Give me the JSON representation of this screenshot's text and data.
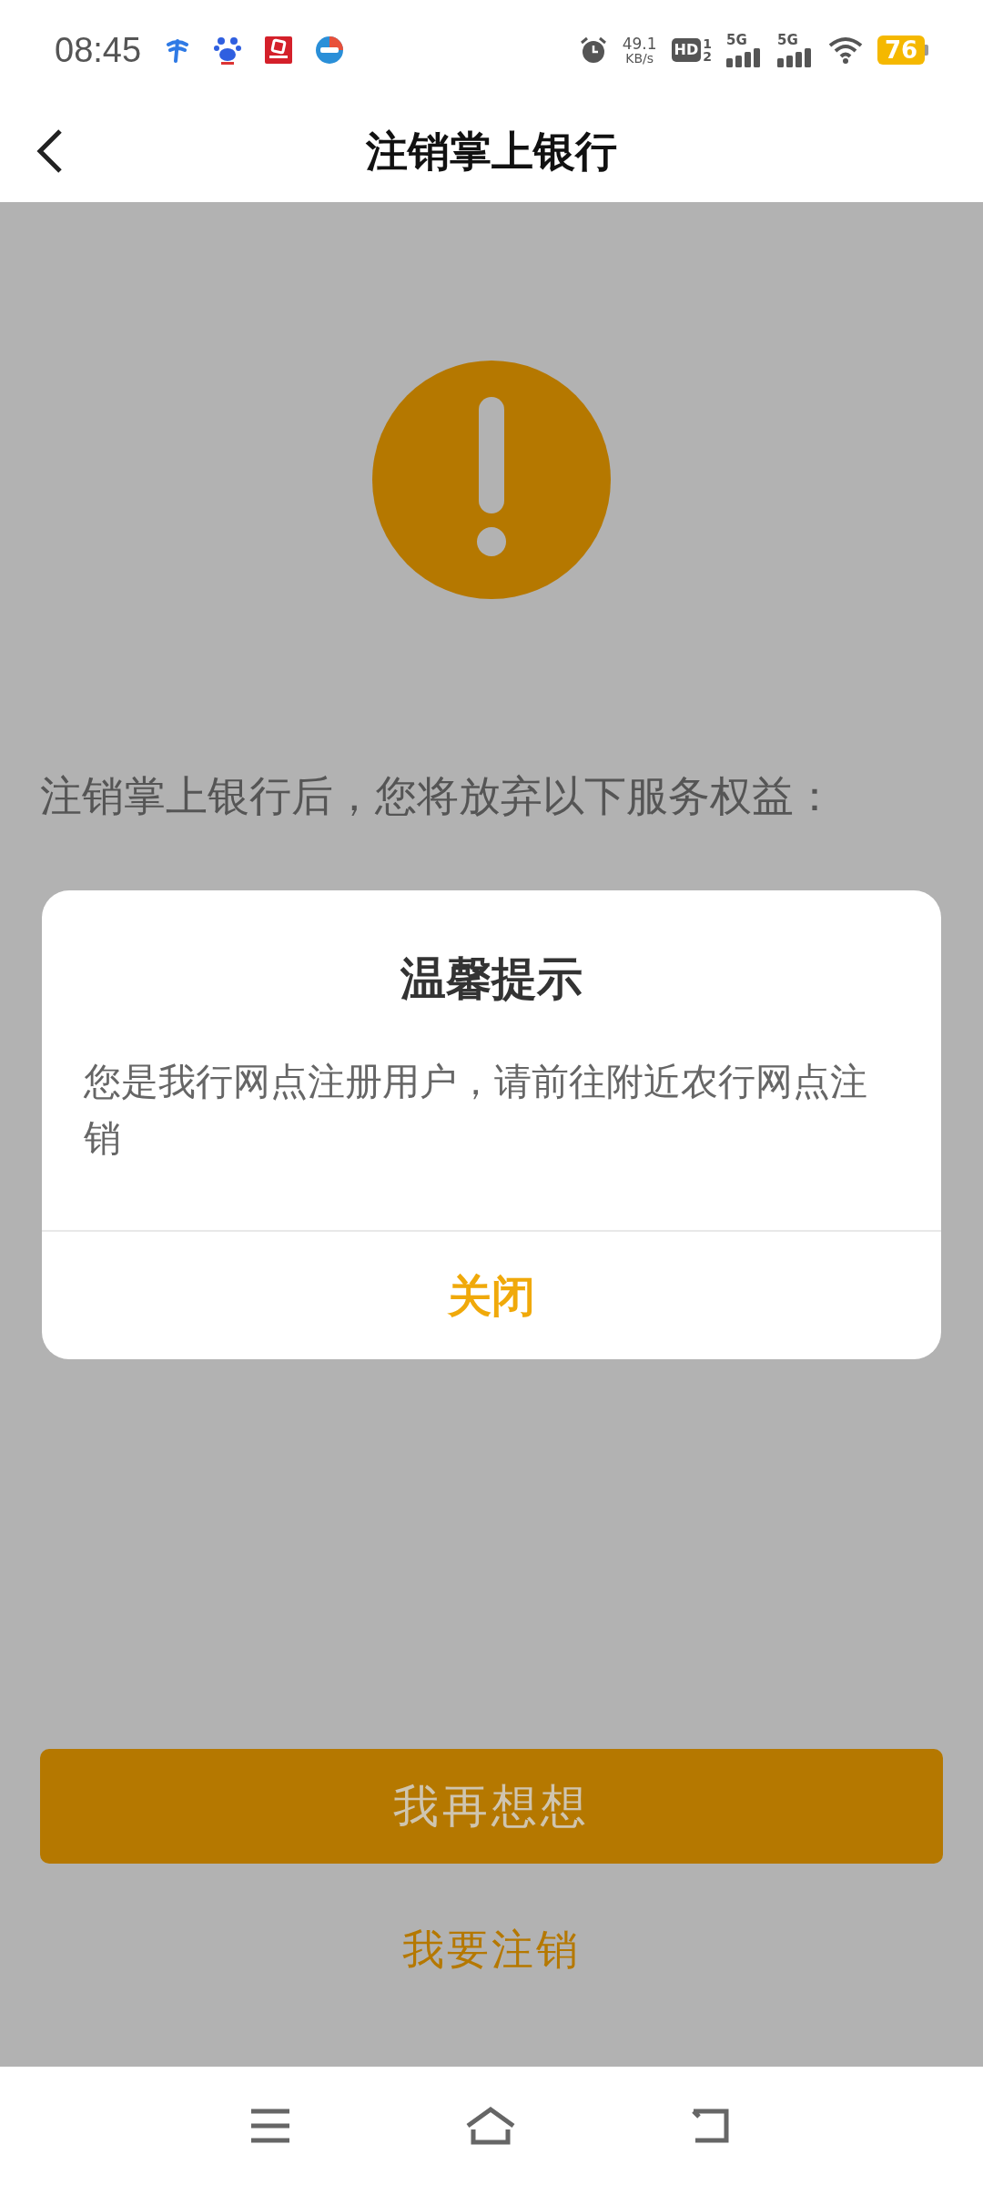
{
  "status_bar": {
    "time": "08:45",
    "speed_value": "49.1",
    "speed_unit": "KB/s",
    "hd": "HD",
    "sim_1": "1",
    "sim_2": "2",
    "networks": [
      "5G",
      "5G"
    ],
    "battery": "76"
  },
  "header": {
    "title": "注销掌上银行"
  },
  "intro": "注销掌上银行后，您将放弃以下服务权益：",
  "dialog": {
    "title": "温馨提示",
    "message": "您是我行网点注册用户，请前往附近农行网点注销",
    "button": "关闭"
  },
  "primary_button": "我再想想",
  "secondary_link": "我要注销"
}
